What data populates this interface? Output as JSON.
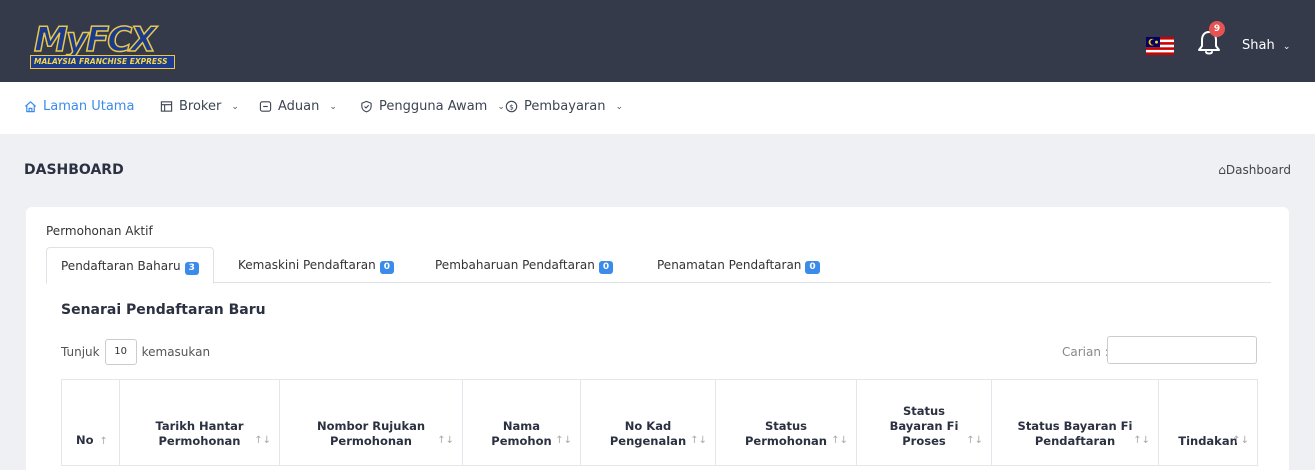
{
  "header": {
    "logo_text": "MyFCX",
    "logo_subtitle": "MALAYSIA FRANCHISE EXPRESS",
    "notification_count": "9",
    "user_name": "Shah"
  },
  "nav": {
    "items": [
      {
        "label": "Laman Utama"
      },
      {
        "label": "Broker"
      },
      {
        "label": "Aduan"
      },
      {
        "label": "Pengguna Awam"
      },
      {
        "label": "Pembayaran"
      }
    ]
  },
  "page": {
    "title": "DASHBOARD",
    "breadcrumb": "Dashboard"
  },
  "card": {
    "heading": "Permohonan Aktif",
    "tabs": [
      {
        "label": "Pendaftaran Baharu",
        "count": "3"
      },
      {
        "label": "Kemaskini Pendaftaran",
        "count": "0"
      },
      {
        "label": "Pembaharuan Pendaftaran",
        "count": "0"
      },
      {
        "label": "Penamatan Pendaftaran",
        "count": "0"
      }
    ],
    "section_title": "Senarai Pendaftaran Baru",
    "length": {
      "prefix": "Tunjuk",
      "value": "10",
      "suffix": "kemasukan"
    },
    "search": {
      "label": "Carian :",
      "value": ""
    },
    "table": {
      "columns": [
        {
          "line1": "No",
          "line2": "",
          "line3": ""
        },
        {
          "line1": "Tarikh Hantar",
          "line2": "Permohonan",
          "line3": ""
        },
        {
          "line1": "Nombor Rujukan",
          "line2": "Permohonan",
          "line3": ""
        },
        {
          "line1": "Nama",
          "line2": "Pemohon",
          "line3": ""
        },
        {
          "line1": "No Kad",
          "line2": "Pengenalan",
          "line3": ""
        },
        {
          "line1": "Status",
          "line2": "Permohonan",
          "line3": ""
        },
        {
          "line1": "Status",
          "line2": "Bayaran Fi",
          "line3": "Proses"
        },
        {
          "line1": "Status Bayaran Fi",
          "line2": "Pendaftaran",
          "line3": ""
        },
        {
          "line1": "Tindakan",
          "line2": "",
          "line3": ""
        }
      ]
    }
  },
  "colors": {
    "topbar": "#343a4a",
    "accent": "#3b8beb",
    "badge_red": "#e55353"
  }
}
